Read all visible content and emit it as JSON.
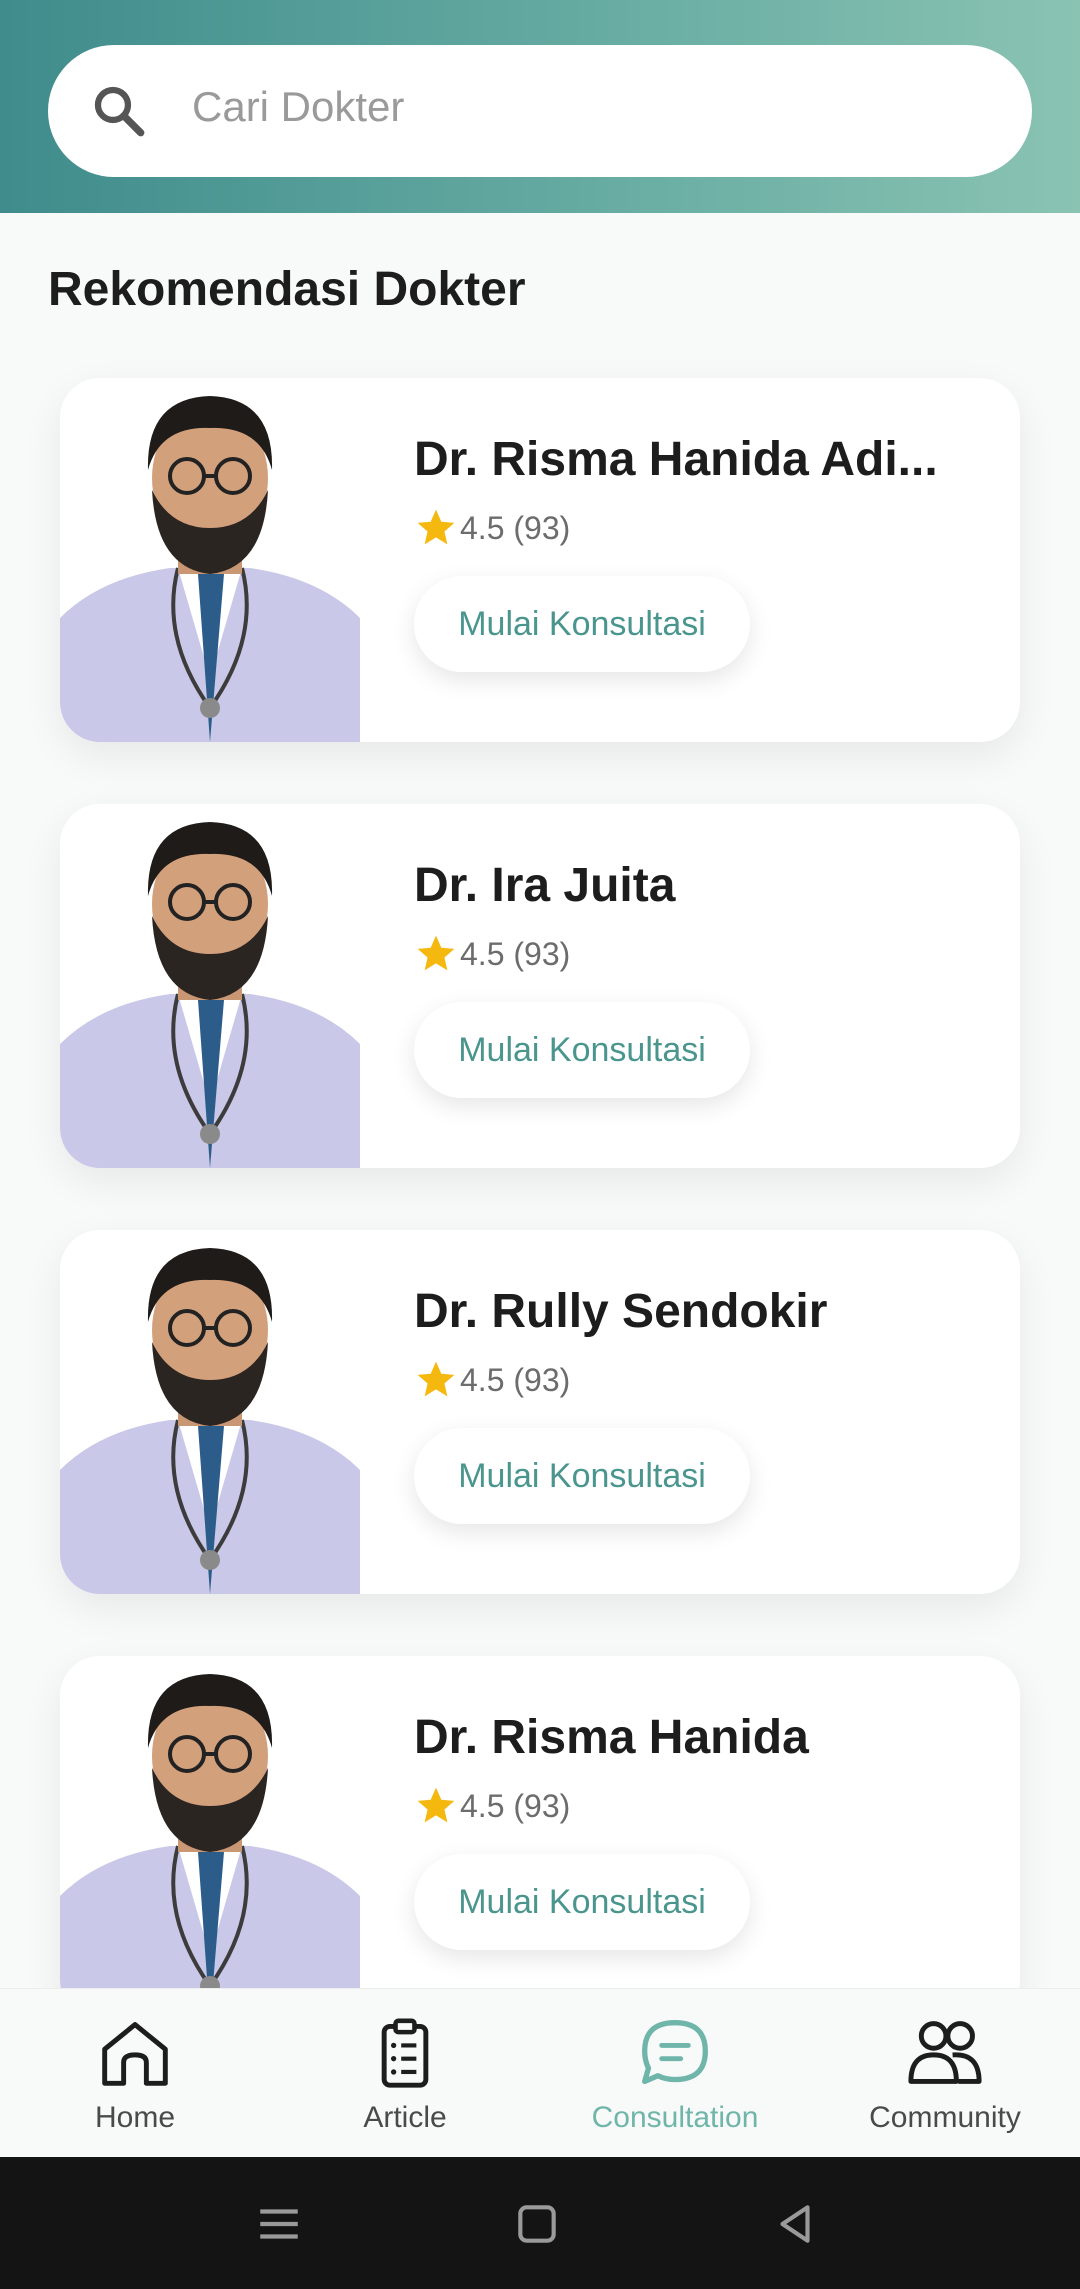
{
  "search": {
    "placeholder": "Cari Dokter"
  },
  "section": {
    "title": "Rekomendasi Dokter"
  },
  "doctors": [
    {
      "name": "Dr. Risma Hanida Adi...",
      "rating": "4.5 (93)",
      "button": "Mulai Konsultasi"
    },
    {
      "name": "Dr. Ira Juita",
      "rating": "4.5 (93)",
      "button": "Mulai Konsultasi"
    },
    {
      "name": "Dr. Rully Sendokir",
      "rating": "4.5 (93)",
      "button": "Mulai Konsultasi"
    },
    {
      "name": "Dr. Risma Hanida",
      "rating": "4.5 (93)",
      "button": "Mulai Konsultasi"
    }
  ],
  "nav": {
    "items": [
      {
        "label": "Home",
        "icon": "home-icon"
      },
      {
        "label": "Article",
        "icon": "clipboard-icon"
      },
      {
        "label": "Consultation",
        "icon": "chat-icon",
        "active": true
      },
      {
        "label": "Community",
        "icon": "people-icon"
      }
    ]
  },
  "colors": {
    "accent": "#6fb5aa",
    "header_start": "#3f8c8c",
    "header_end": "#8ac3b2",
    "star": "#f5b80f"
  },
  "system_nav": [
    "menu-icon",
    "home-square-icon",
    "back-icon"
  ]
}
